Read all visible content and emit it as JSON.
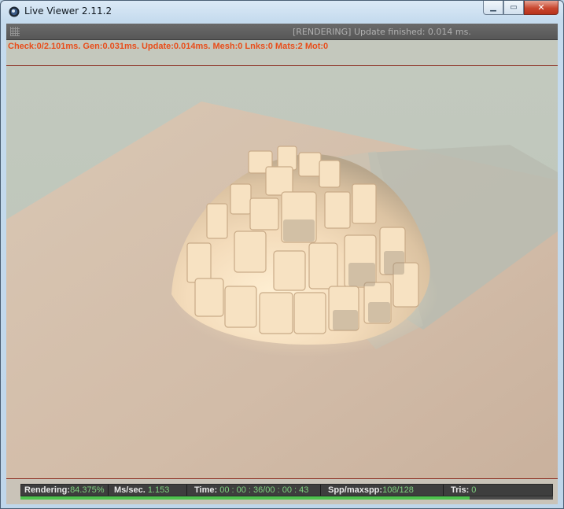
{
  "window": {
    "title": "Live Viewer 2.11.2",
    "minimize_glyph": "▁",
    "maximize_glyph": "▭",
    "close_glyph": "✕"
  },
  "status": {
    "text": "[RENDERING] Update finished: 0.014 ms."
  },
  "stats": {
    "text": "Check:0/2.101ms. Gen:0.031ms. Update:0.014ms. Mesh:0 Lnks:0 Mats:2 Mot:0"
  },
  "statusbar": {
    "rendering_label": "Rendering:",
    "rendering_value": "84.375%",
    "ms_label": "Ms/sec.",
    "ms_value": "1.153",
    "time_label": "Time:",
    "time_value": "00 : 00 : 36/00 : 00 : 43",
    "spp_label": "Spp/maxspp:",
    "spp_value": "108/128",
    "tris_label": "Tris:",
    "tris_value": "0",
    "progress": 0.84375
  },
  "colors": {
    "stats_text": "#e84d1a",
    "value_green": "#7fd27f",
    "progress_green": "#4ec24e"
  },
  "icons": {
    "app": "cinema4d-icon",
    "grip": "grip-icon"
  }
}
